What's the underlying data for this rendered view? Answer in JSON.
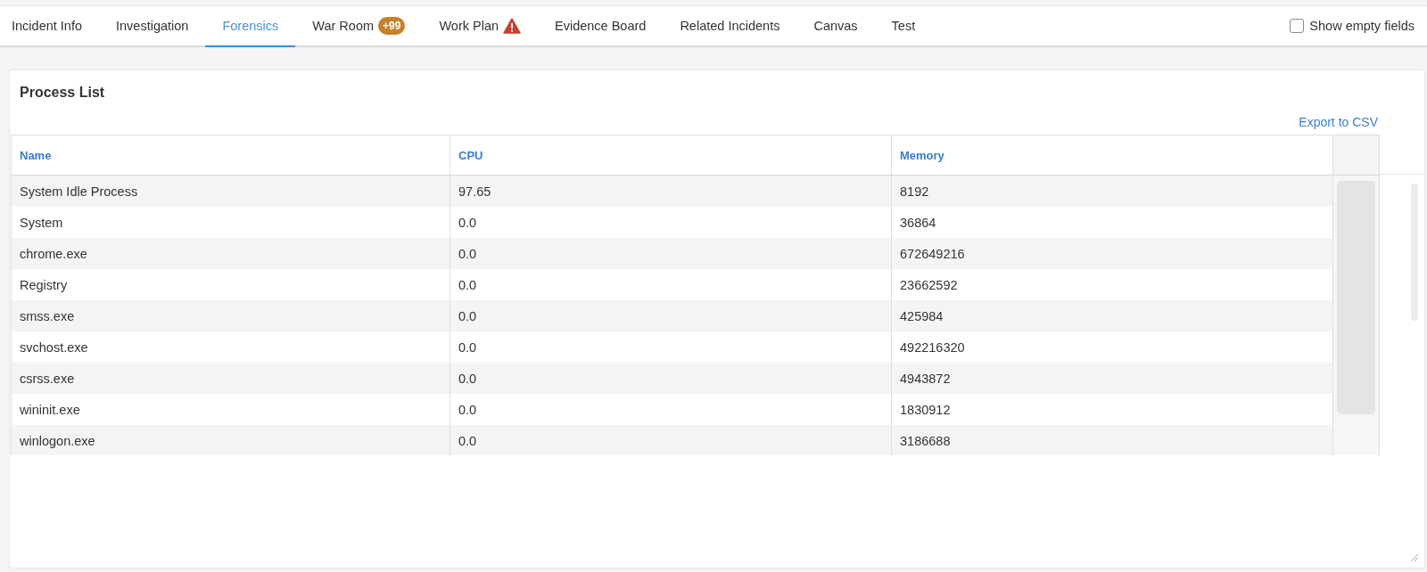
{
  "tabs": [
    {
      "label": "Incident Info",
      "selected": false
    },
    {
      "label": "Investigation",
      "selected": false
    },
    {
      "label": "Forensics",
      "selected": true
    },
    {
      "label": "War Room",
      "selected": false,
      "badge": "+99"
    },
    {
      "label": "Work Plan",
      "selected": false,
      "warning": true
    },
    {
      "label": "Evidence Board",
      "selected": false
    },
    {
      "label": "Related Incidents",
      "selected": false
    },
    {
      "label": "Canvas",
      "selected": false
    },
    {
      "label": "Test",
      "selected": false
    }
  ],
  "show_empty_fields": {
    "label": "Show empty fields",
    "checked": false
  },
  "panel": {
    "title": "Process List",
    "export_link": "Export to CSV",
    "table": {
      "columns": [
        "Name",
        "CPU",
        "Memory"
      ],
      "rows": [
        [
          "System Idle Process",
          "97.65",
          "8192"
        ],
        [
          "System",
          "0.0",
          "36864"
        ],
        [
          "chrome.exe",
          "0.0",
          "672649216"
        ],
        [
          "Registry",
          "0.0",
          "23662592"
        ],
        [
          "smss.exe",
          "0.0",
          "425984"
        ],
        [
          "svchost.exe",
          "0.0",
          "492216320"
        ],
        [
          "csrss.exe",
          "0.0",
          "4943872"
        ],
        [
          "wininit.exe",
          "0.0",
          "1830912"
        ],
        [
          "winlogon.exe",
          "0.0",
          "3186688"
        ]
      ]
    }
  }
}
